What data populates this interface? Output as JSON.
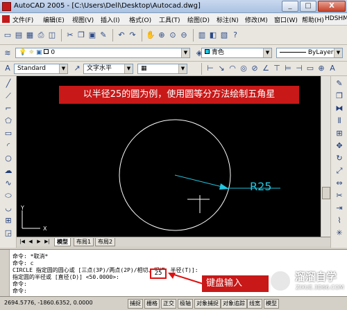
{
  "window": {
    "title": "AutoCAD 2005 - [C:\\Users\\Dell\\Desktop\\Autocad.dwg]",
    "minimize": "_",
    "restore": "□",
    "close": "X"
  },
  "menu": {
    "items": [
      "文件(F)",
      "编辑(E)",
      "视图(V)",
      "插入(I)",
      "格式(O)",
      "工具(T)",
      "绘图(D)",
      "标注(N)",
      "修改(M)",
      "窗口(W)",
      "帮助(H)",
      "HDSHM"
    ]
  },
  "toolbar_layers": {
    "layer_value": "0",
    "color_value": "青色",
    "linetype_value": "ByLayer"
  },
  "toolbar_styles": {
    "text_style": "Standard",
    "dim_style": "文字水平"
  },
  "canvas": {
    "annotation": "以半径25的圆为例，使用圆等分方法绘制五角星",
    "radius_label": "R25",
    "ucs_y": "Y",
    "ucs_x": "X"
  },
  "layout_tabs": {
    "tabs": [
      "模型",
      "布局1",
      "布局2"
    ],
    "active": "模型"
  },
  "command": {
    "lines": [
      "命令: *取消*",
      "命令: c",
      "CIRCLE 指定圆的圆心或 [三点(3P)/两点(2P)/相切、相切、半径(T)]:",
      "指定圆的半径或 [直径(D)] <50.0000>:",
      "命令:",
      "命令:"
    ],
    "typed_value": "25"
  },
  "callout": {
    "text": "键盘输入"
  },
  "watermark": {
    "title": "溜溜自学",
    "subtitle": "ZIXUE.3D66.COM"
  },
  "status": {
    "coords": "2694.5776, -1860.6352, 0.0000",
    "buttons": [
      "捕捉",
      "栅格",
      "正交",
      "极轴",
      "对象捕捉",
      "对象追踪",
      "线宽",
      "模型"
    ]
  },
  "colors": {
    "circle": "#ffffff",
    "leader": "#22c6e0",
    "annotation_bg": "#c81818"
  }
}
